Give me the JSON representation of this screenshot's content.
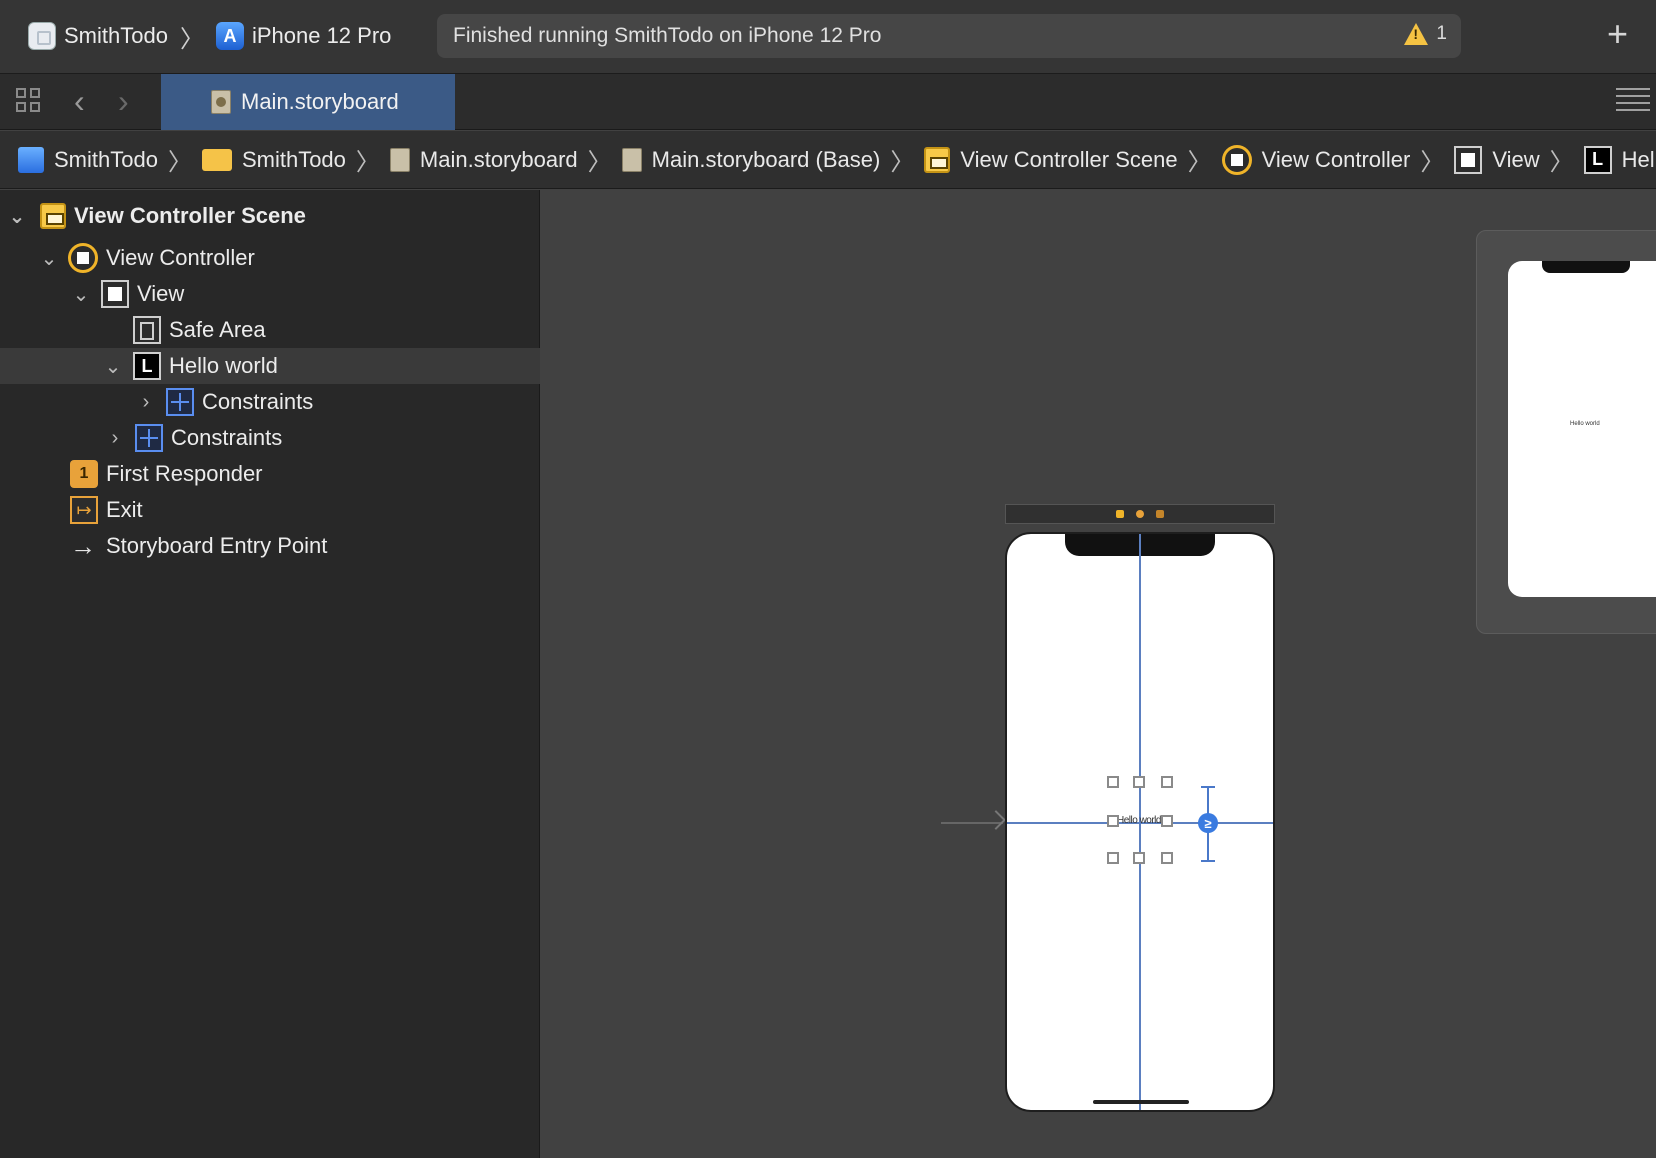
{
  "toolbar": {
    "scheme_name": "SmithTodo",
    "destination": "iPhone 12 Pro",
    "status_text": "Finished running SmithTodo on iPhone 12 Pro",
    "warning_count": "1",
    "add_symbol": "+"
  },
  "tabs": [
    {
      "label": "Main.storyboard",
      "active": true
    }
  ],
  "jumpbar": [
    {
      "label": "SmithTodo",
      "icon": "project-icon"
    },
    {
      "label": "SmithTodo",
      "icon": "folder-icon"
    },
    {
      "label": "Main.storyboard",
      "icon": "storyboard-file-icon"
    },
    {
      "label": "Main.storyboard (Base)",
      "icon": "storyboard-file-icon"
    },
    {
      "label": "View Controller Scene",
      "icon": "scene-icon"
    },
    {
      "label": "View Controller",
      "icon": "view-controller-icon"
    },
    {
      "label": "View",
      "icon": "view-icon"
    },
    {
      "label": "Hello w",
      "icon": "label-icon"
    }
  ],
  "outline": [
    {
      "label": "View Controller Scene",
      "icon": "scene-icon",
      "disclosure": "expanded",
      "level": 0,
      "bold": true
    },
    {
      "label": "View Controller",
      "icon": "view-controller-icon",
      "disclosure": "expanded",
      "level": 1
    },
    {
      "label": "View",
      "icon": "view-icon",
      "disclosure": "expanded",
      "level": 2
    },
    {
      "label": "Safe Area",
      "icon": "safe-area-icon",
      "disclosure": "none",
      "level": 3
    },
    {
      "label": "Hello world",
      "icon": "label-icon",
      "disclosure": "expanded",
      "level": 3,
      "selected": true
    },
    {
      "label": "Constraints",
      "icon": "constraints-icon",
      "disclosure": "collapsed",
      "level": 4
    },
    {
      "label": "Constraints",
      "icon": "constraints-icon",
      "disclosure": "collapsed",
      "level": 3
    },
    {
      "label": "First Responder",
      "icon": "first-responder-icon",
      "disclosure": "none",
      "level": 1
    },
    {
      "label": "Exit",
      "icon": "exit-icon",
      "disclosure": "none",
      "level": 1
    },
    {
      "label": "Storyboard Entry Point",
      "icon": "entry-point-arrow-icon",
      "disclosure": "none",
      "level": 1
    }
  ],
  "canvas": {
    "label_text": "Hello world",
    "constraint_badge": "≥",
    "mini_label_text": "Hello world"
  },
  "colors": {
    "accent_tab": "#3b5a86",
    "constraint_blue": "#5b7fc0",
    "warning_yellow": "#f5c343"
  }
}
